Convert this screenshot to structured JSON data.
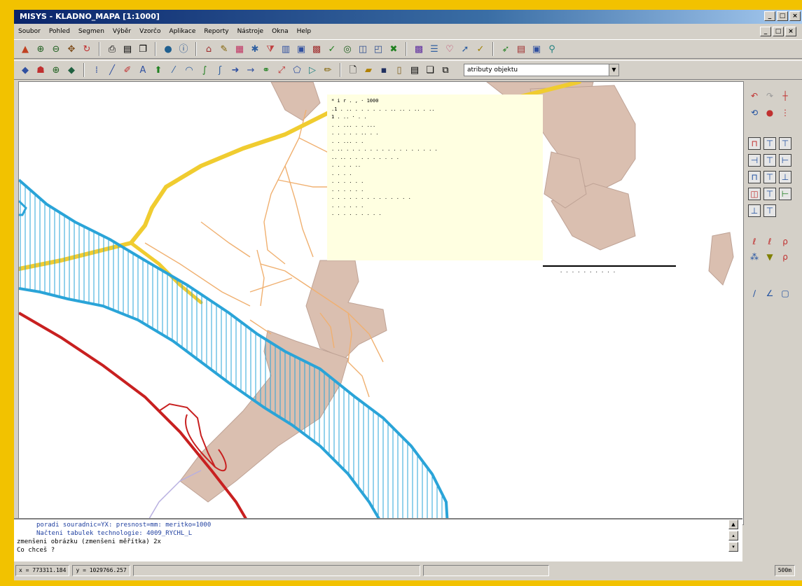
{
  "window": {
    "title": "MISYS - KLADNO_MAPA [1:1000]"
  },
  "menu": [
    "Soubor",
    "Pohled",
    "Segmen",
    "Výběr",
    "Vzorčo",
    "Aplikace",
    "Reporty",
    "Nástroje",
    "Okna",
    "Help"
  ],
  "toolbar": {
    "combo_value": "atributy objektu"
  },
  "icons": {
    "toolbar1": [
      "layers-icon",
      "zoom-in-icon",
      "zoom-out-icon",
      "pan-icon",
      "refresh-icon",
      "print-icon",
      "print-preview-icon",
      "copy-icon",
      "globe-icon",
      "info-icon",
      "house-icon",
      "edit-icon",
      "table-icon",
      "select-icon",
      "filter-icon",
      "grid-icon",
      "palette-icon",
      "settings-icon",
      "tools-icon"
    ],
    "toolbar2": [
      "diamond-icon",
      "cursor-icon",
      "magnify-icon",
      "diamond2-icon",
      "line-icon",
      "pen-icon",
      "text-icon",
      "arrow-icon",
      "curve-icon",
      "move-icon",
      "new-file-icon",
      "open-folder-icon",
      "save-icon",
      "document-icon"
    ]
  },
  "popup": {
    "lines": [
      "* i    r  . ,  · 1000",
      "  .1 .  ..  . . .  .  .   .  .. ..  .  ..  .  ..",
      "    1  . ..  ·  .  .",
      " .  . ...  .  . ...",
      "     . .  .  .  . ..  .  .",
      " .  . ... .  .",
      " .  .. .  .  . .  .  .  . .  .  .  .   .  .  . .  .",
      " .. .. . .  . .  .  .  .  .  .",
      " .    .  .  . ..",
      "   .  .  . .",
      "  .  . .  .  .  .",
      "  .  .  .  . . .",
      " .  .  .  .  .  . .  .  .  .  . .  .  .",
      " .  . .  .  .  .",
      "  . .  .  .   .  .  .  .  ."
    ],
    "footer": ". . .  .  .  . .  .  . ."
  },
  "command": {
    "line1": "poradi souradnic=YX: presnost=mm: meritko=1000",
    "line2": "Načteni tabulek technologie: 4009_RYCHL_L",
    "line3": "zmenšeni obrázku (zmenšeni měřítka) 2x",
    "line4": "Co chceš ?"
  },
  "status": {
    "x": "x = 773311.184",
    "y": "y = 1029766.257",
    "scale": "500m"
  },
  "colors": {
    "road_yellow": "#f0cc30",
    "river_blue": "#2aa4d8",
    "railway_red": "#c82020",
    "building_fill": "#d7b9a8",
    "street_orange": "#f0b070"
  }
}
